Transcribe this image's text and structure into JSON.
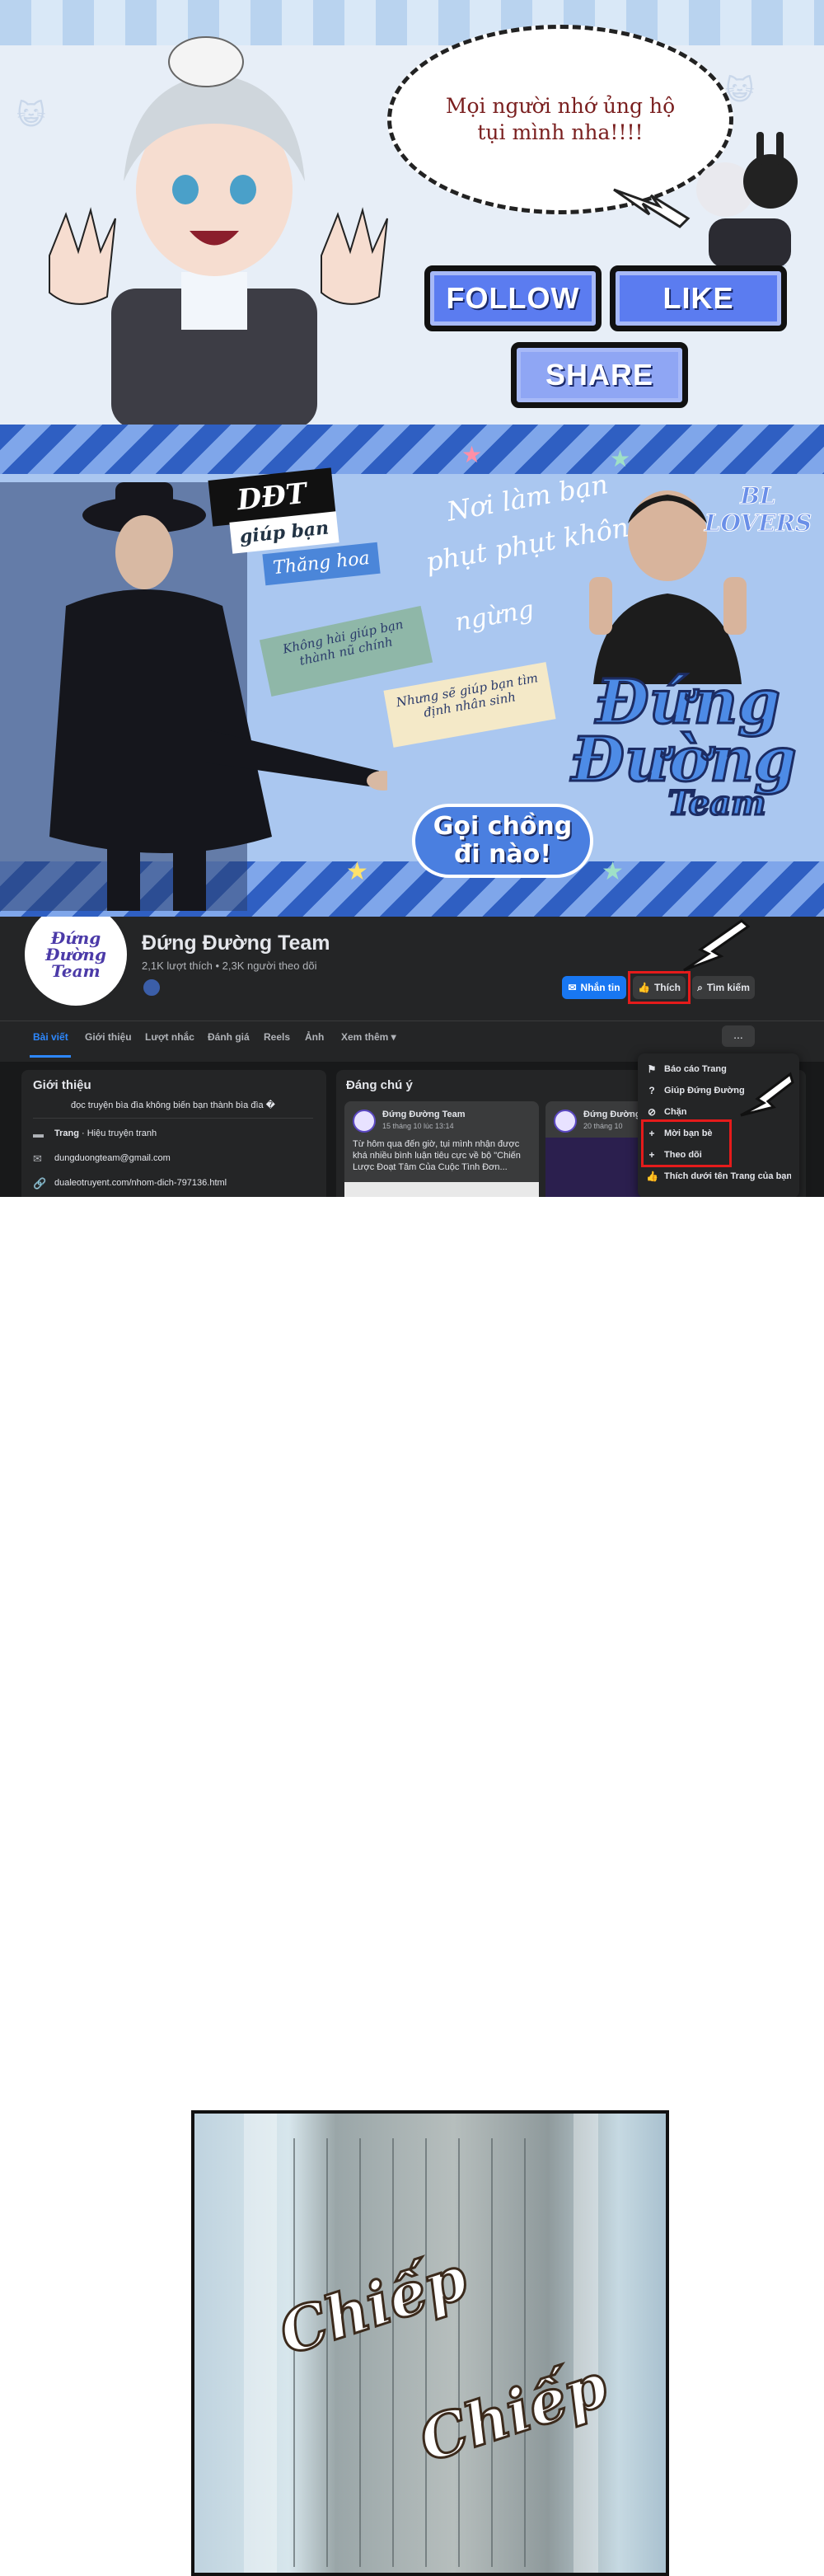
{
  "banner1": {
    "speech_line1": "Mọi người nhớ ủng hộ",
    "speech_line2": "tụi mình nha!!!!",
    "follow_label": "FOLLOW",
    "like_label": "LIKE",
    "share_label": "SHARE",
    "accent_color": "#5b7cf0"
  },
  "banner2": {
    "tag_ddt": "DĐT",
    "tag_giup_ban": "giúp bạn",
    "tag_thang_hoa": "Thăng hoa",
    "script_line1": "Nơi làm bạn",
    "script_line2": "phụt phụt không",
    "script_line3": "ngừng",
    "note_left": "Không hài giúp bạn thành nũ chính",
    "note_right": "Nhưng sẽ giúp bạn tìm định nhân sinh",
    "bl_lovers": "BL LOVERS",
    "team_title_line1": "Đứng",
    "team_title_line2": "Đường",
    "team_title_line3": "Team",
    "call_line1": "Gọi chồng",
    "call_line2": "đi nào!"
  },
  "fb": {
    "avatar_text": "Đứng Đường Team",
    "page_name": "Đứng Đường Team",
    "stats": "2,1K lượt thích • 2,3K người theo dõi",
    "message_label": "Nhắn tin",
    "like_label": "Thích",
    "search_label": "Tìm kiếm",
    "more_label": "...",
    "tabs": [
      "Bài viết",
      "Giới thiệu",
      "Lượt nhắc",
      "Đánh giá",
      "Reels",
      "Ảnh",
      "Xem thêm ▾"
    ],
    "intro": {
      "title": "Giới thiệu",
      "bio": "đọc truyện bìa đìa không biến bạn thành bìa đìa �",
      "category_bold": "Trang",
      "category": " · Hiệu truyện tranh",
      "email": "dungduongteam@gmail.com",
      "link": "dualeotruyent.com/nhom-dich-797136.html"
    },
    "featured": {
      "title": "Đáng chú ý",
      "post1_author": "Đứng Đường Team",
      "post1_date": "15 tháng 10 lúc 13:14",
      "post1_text1": "Từ hôm qua đến giờ, tụi mình nhận được",
      "post1_text2": "khá nhiều bình luận tiêu cực về bộ \"Chiến",
      "post1_text3": "Lược Đoạt Tâm Của Cuộc Tình Đơn...",
      "post2_author": "Đứng Đường Te",
      "post2_date": "20 tháng 10"
    },
    "menu": [
      {
        "icon": "report-icon",
        "glyph": "⚑",
        "label": "Báo cáo Trang"
      },
      {
        "icon": "help-icon",
        "glyph": "?",
        "label": "Giúp Đứng Đường"
      },
      {
        "icon": "block-icon",
        "glyph": "⊘",
        "label": "Chặn"
      },
      {
        "icon": "invite-icon",
        "glyph": "+",
        "label": "Mời bạn bè"
      },
      {
        "icon": "follow-icon",
        "glyph": "+",
        "label": "Theo dõi"
      },
      {
        "icon": "like-icon",
        "glyph": "👍",
        "label": "Thích dưới tên Trang của bạn"
      }
    ]
  },
  "panel": {
    "sfx1": "Chiếp",
    "sfx2": "Chiếp"
  }
}
